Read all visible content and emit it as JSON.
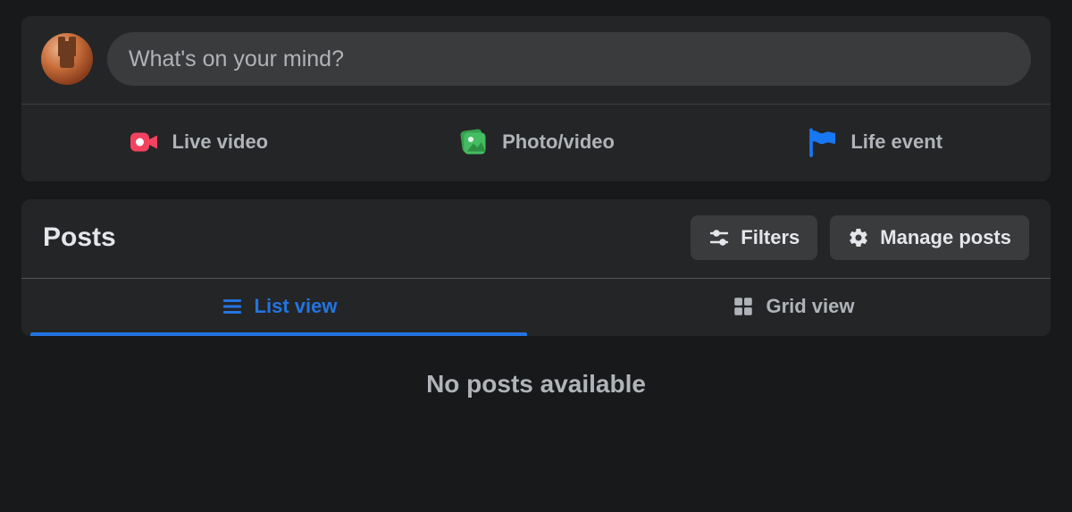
{
  "composer": {
    "placeholder": "What's on your mind?",
    "actions": {
      "live_video": "Live video",
      "photo_video": "Photo/video",
      "life_event": "Life event"
    }
  },
  "posts": {
    "title": "Posts",
    "filters_label": "Filters",
    "manage_label": "Manage posts",
    "tabs": {
      "list": "List view",
      "grid": "Grid view"
    },
    "empty_message": "No posts available"
  },
  "colors": {
    "live_video_icon": "#f3425f",
    "photo_video_icon": "#45bd62",
    "life_event_icon": "#1877f2",
    "accent": "#2374e1"
  }
}
